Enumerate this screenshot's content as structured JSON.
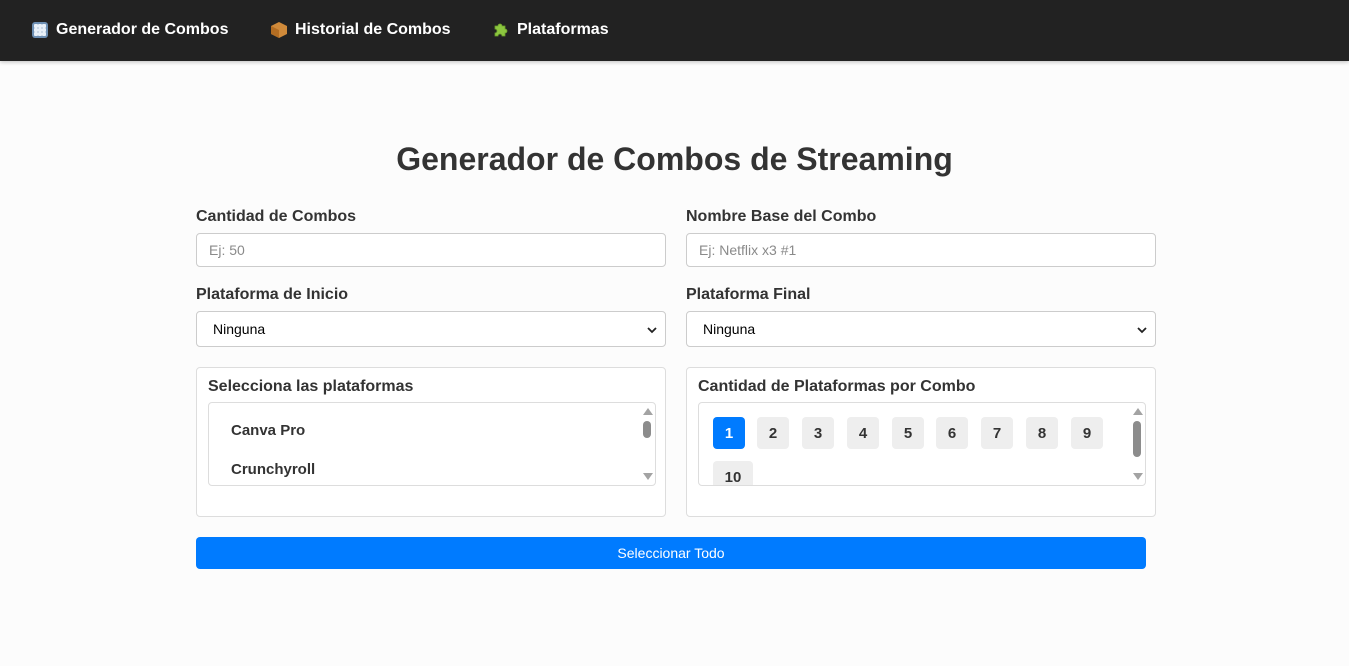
{
  "nav": {
    "items": [
      {
        "label": "Generador de Combos",
        "icon": "control-knobs-icon"
      },
      {
        "label": "Historial de Combos",
        "icon": "package-icon"
      },
      {
        "label": "Plataformas",
        "icon": "puzzle-piece-icon"
      }
    ]
  },
  "page": {
    "title": "Generador de Combos de Streaming"
  },
  "form": {
    "cantidad_label": "Cantidad de Combos",
    "cantidad_placeholder": "Ej: 50",
    "nombre_label": "Nombre Base del Combo",
    "nombre_placeholder": "Ej: Netflix x3 #1",
    "inicio_label": "Plataforma de Inicio",
    "inicio_value": "Ninguna",
    "final_label": "Plataforma Final",
    "final_value": "Ninguna"
  },
  "platforms_panel": {
    "title": "Selecciona las plataformas",
    "items": [
      "Canva Pro",
      "Crunchyroll"
    ]
  },
  "count_panel": {
    "title": "Cantidad de Plataformas por Combo",
    "options": [
      "1",
      "2",
      "3",
      "4",
      "5",
      "6",
      "7",
      "8",
      "9",
      "10"
    ],
    "selected": "1"
  },
  "actions": {
    "select_all_label": "Seleccionar Todo"
  },
  "colors": {
    "navbar": "#222222",
    "accent": "#007bff",
    "background": "#fcfcfc"
  }
}
